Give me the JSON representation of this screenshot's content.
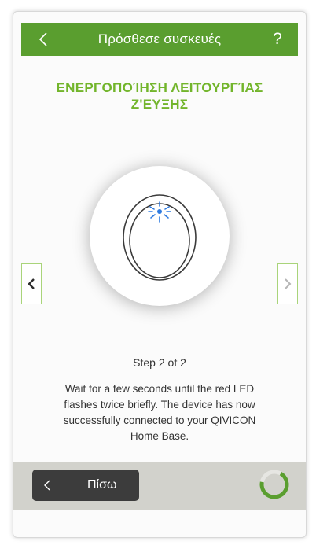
{
  "header": {
    "title": "Πρόσθεσε συσκευές",
    "help_label": "?"
  },
  "section": {
    "title": "ΕΝΕΡΓΟΠΟΊΗΣΗ ΛΕΙΤΟΥΡΓΊΑΣ Ζ'ΕΥΞΗΣ"
  },
  "step": {
    "label": "Step 2 of 2",
    "description": "Wait for a few seconds until the red LED flashes twice briefly. The device has now successfully connected to your QIVICON Home Base."
  },
  "footer": {
    "back_label": "Πίσω"
  },
  "colors": {
    "brand_green": "#5a9e2f",
    "title_green": "#72b52b",
    "nav_border": "#a9d47a",
    "led_blue": "#2f7be0",
    "dark_button": "#3c3c3c",
    "footer_bg": "#d2d2cc"
  },
  "icons": {
    "back": "chevron-left-icon",
    "prev": "chevron-left-icon",
    "next": "chevron-right-icon",
    "device": "device-ring-led-icon",
    "loading": "loading-spinner-icon"
  }
}
